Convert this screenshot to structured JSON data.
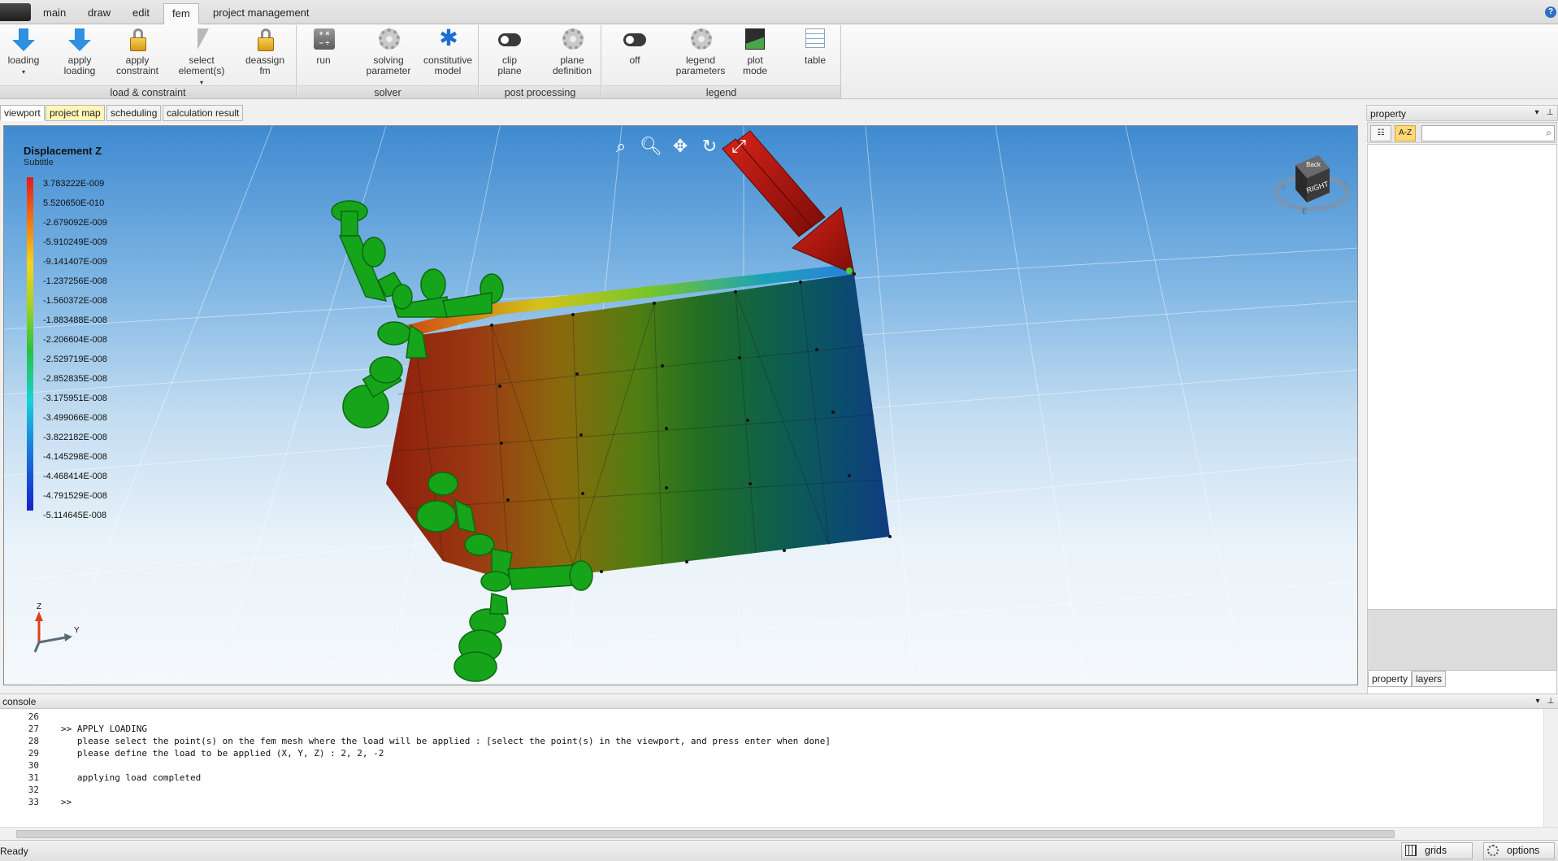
{
  "ribbon": {
    "tabs": [
      "main",
      "draw",
      "edit",
      "fem",
      "project management"
    ],
    "active_tab": "fem",
    "groups": [
      {
        "label": "load & constraint"
      },
      {
        "label": "solver"
      },
      {
        "label": "post processing"
      },
      {
        "label": "legend"
      }
    ],
    "buttons": {
      "loading": "loading",
      "apply_loading": "apply\nloading",
      "apply_constraint": "apply\nconstraint",
      "select_elements": "select\nelement(s)",
      "deassign_fm": "deassign\nfm",
      "run": "run",
      "solving_parameter": "solving\nparameter",
      "constitutive_model": "constitutive\nmodel",
      "clip_plane": "clip\nplane",
      "plane_definition": "plane\ndefinition",
      "off": "off",
      "legend_parameters": "legend\nparameters",
      "plot_mode": "plot\nmode",
      "table": "table"
    }
  },
  "doc_tabs": [
    "viewport",
    "project map",
    "scheduling",
    "calculation result"
  ],
  "viewport": {
    "legend": {
      "title": "Displacement Z",
      "subtitle": "Subtitle",
      "values": [
        "3.783222E-009",
        "5.520650E-010",
        "-2.679092E-009",
        "-5.910249E-009",
        "-9.141407E-009",
        "-1.237256E-008",
        "-1.560372E-008",
        "-1.883488E-008",
        "-2.206604E-008",
        "-2.529719E-008",
        "-2.852835E-008",
        "-3.175951E-008",
        "-3.499066E-008",
        "-3.822182E-008",
        "-4.145298E-008",
        "-4.468414E-008",
        "-4.791529E-008",
        "-5.114645E-008"
      ]
    },
    "view_cube": {
      "face_label": "RIGHT",
      "top_label": "Back",
      "left_label": "S",
      "right_label": "N",
      "bottom_label": "E"
    },
    "axis_triad": {
      "z_label": "Z",
      "y_label": "Y"
    }
  },
  "property_panel": {
    "title": "property",
    "sort_label": "A-Z",
    "search_placeholder": "",
    "tabs": [
      "property",
      "layers"
    ]
  },
  "console": {
    "title": "console",
    "lines": [
      {
        "num": "26",
        "text": ""
      },
      {
        "num": "27",
        "text": ">> APPLY LOADING"
      },
      {
        "num": "28",
        "text": "   please select the point(s) on the fem mesh where the load will be applied : [select the point(s) in the viewport, and press enter when done]"
      },
      {
        "num": "29",
        "text": "   please define the load to be applied (X, Y, Z) : 2, 2, -2"
      },
      {
        "num": "30",
        "text": ""
      },
      {
        "num": "31",
        "text": "   applying load completed"
      },
      {
        "num": "32",
        "text": ""
      },
      {
        "num": "33",
        "text": ">>"
      }
    ]
  },
  "statusbar": {
    "status": "Ready",
    "grids_label": "grids",
    "options_label": "options"
  },
  "colors": {
    "accent": "#2f8fe0",
    "support": "#16a41b",
    "load_arrow": "#b81a12"
  }
}
